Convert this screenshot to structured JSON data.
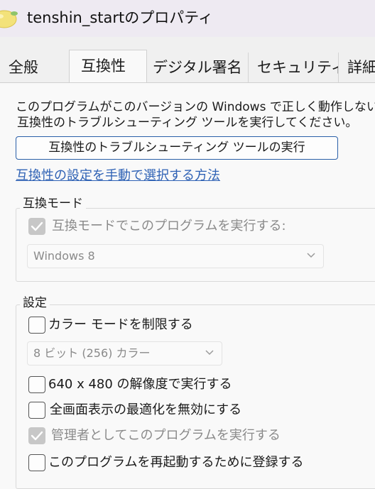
{
  "window": {
    "title": "tenshin_startのプロパティ",
    "icon": "lemon-app-icon"
  },
  "tabs": [
    {
      "label": "全般",
      "active": false
    },
    {
      "label": "互換性",
      "active": true
    },
    {
      "label": "デジタル署名",
      "active": false
    },
    {
      "label": "セキュリティ",
      "active": false
    },
    {
      "label": "詳細",
      "active": false
    }
  ],
  "compat": {
    "intro_line1": "このプログラムがこのバージョンの Windows で正しく動作しない場",
    "intro_line2": "互換性のトラブルシューティング ツールを実行してください。",
    "troubleshooter_button": "互換性のトラブルシューティング ツールの実行",
    "manual_link": "互換性の設定を手動で選択する方法",
    "mode_group": {
      "legend": "互換モード",
      "checkbox_label": "互換モードでこのプログラムを実行する:",
      "checkbox_checked": true,
      "checkbox_enabled": false,
      "os_select_value": "Windows 8"
    },
    "settings_group": {
      "legend": "設定",
      "reduced_color": {
        "label": "カラー モードを制限する",
        "checked": false
      },
      "color_select_value": "8 ビット (256) カラー",
      "res_640": {
        "label": "640 x 480 の解像度で実行する",
        "checked": false
      },
      "fullscreen_opt": {
        "label": "全画面表示の最適化を無効にする",
        "checked": false
      },
      "run_as_admin": {
        "label": "管理者としてこのプログラムを実行する",
        "checked": true,
        "enabled": false
      },
      "register_restart": {
        "label": "このプログラムを再起動するために登録する",
        "checked": false
      }
    }
  },
  "colors": {
    "accent": "#2f62b5",
    "button_border": "#2a5fa8",
    "disabled_check": "#c7c7c7",
    "titlebar_bg": "#eeeaf2"
  }
}
